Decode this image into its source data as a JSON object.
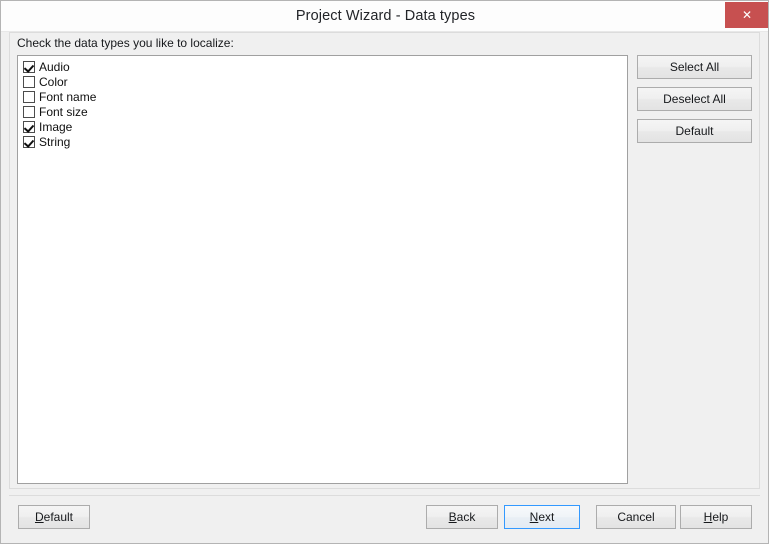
{
  "window": {
    "title": "Project Wizard - Data types",
    "close_icon": "close-icon",
    "close_glyph": "✕",
    "accent_close_color": "#c75050",
    "background_color": "#f0f0f0",
    "titlebar_color": "#fdfdfd"
  },
  "content": {
    "instruction": "Check the data types you like to localize:",
    "checklist": [
      {
        "label": "Audio",
        "checked": true
      },
      {
        "label": "Color",
        "checked": false
      },
      {
        "label": "Font name",
        "checked": false
      },
      {
        "label": "Font size",
        "checked": false
      },
      {
        "label": "Image",
        "checked": true
      },
      {
        "label": "String",
        "checked": true
      }
    ]
  },
  "side_buttons": {
    "select_all": "Select All",
    "deselect_all": "Deselect All",
    "default": "Default"
  },
  "footer": {
    "default": {
      "pre": "",
      "mnemonic": "D",
      "post": "efault"
    },
    "back": {
      "pre": "",
      "mnemonic": "B",
      "post": "ack"
    },
    "next": {
      "pre": "",
      "mnemonic": "N",
      "post": "ext",
      "focused": true,
      "focus_color": "#3399ff"
    },
    "cancel": {
      "pre": "Cancel",
      "mnemonic": "",
      "post": ""
    },
    "help": {
      "pre": "",
      "mnemonic": "H",
      "post": "elp"
    }
  }
}
